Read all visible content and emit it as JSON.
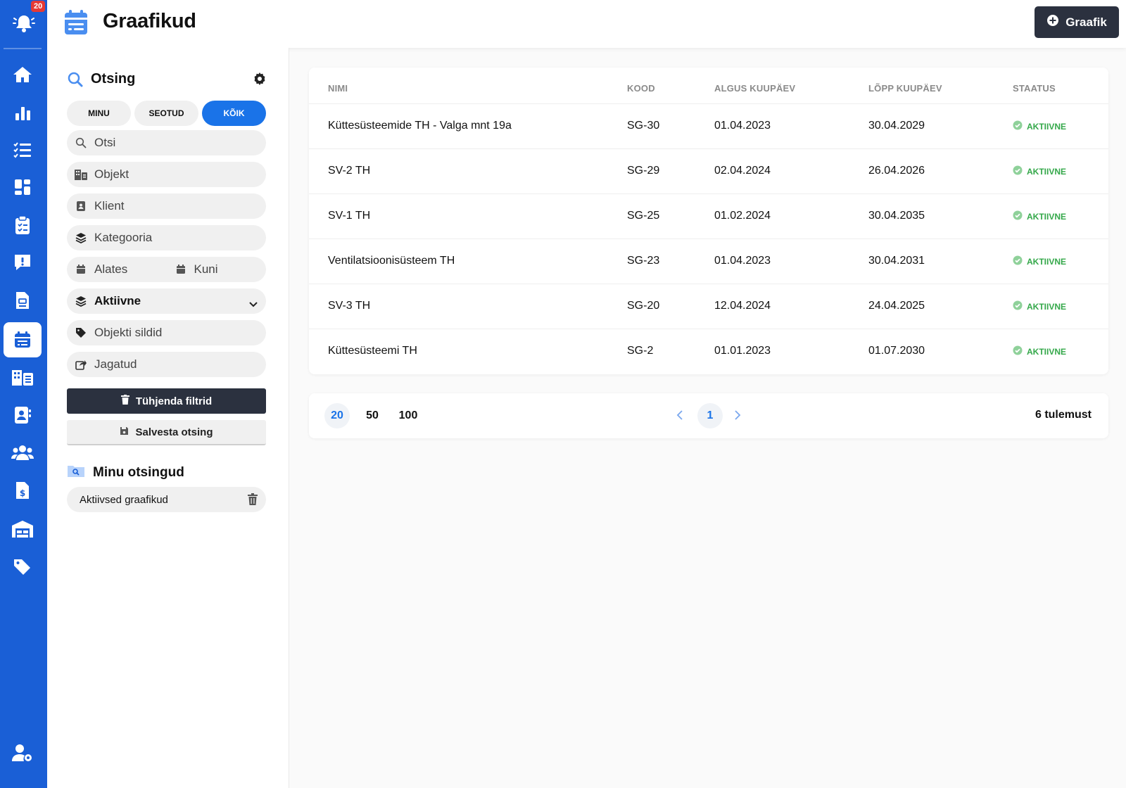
{
  "app": {
    "title": "Graafikud",
    "add_button": "Graafik"
  },
  "nav": {
    "notification_count": "20"
  },
  "search": {
    "title": "Otsing",
    "scopes": [
      {
        "label": "MINU",
        "active": false
      },
      {
        "label": "SEOTUD",
        "active": false
      },
      {
        "label": "KÕIK",
        "active": true
      }
    ],
    "text_placeholder": "Otsi",
    "object_placeholder": "Objekt",
    "client_placeholder": "Klient",
    "category_placeholder": "Kategooria",
    "date_from_placeholder": "Alates",
    "date_to_placeholder": "Kuni",
    "status_value": "Aktiivne",
    "tags_placeholder": "Objekti sildid",
    "shared_placeholder": "Jagatud",
    "clear_button": "Tühjenda filtrid",
    "save_button": "Salvesta otsing"
  },
  "saved_searches": {
    "title": "Minu otsingud",
    "items": [
      {
        "label": "Aktiivsed graafikud"
      }
    ]
  },
  "table": {
    "columns": [
      "NIMI",
      "KOOD",
      "ALGUS KUUPÄEV",
      "LÕPP KUUPÄEV",
      "STAATUS"
    ],
    "rows": [
      {
        "name": "Küttesüsteemide TH - Valga mnt 19a",
        "code": "SG-30",
        "start": "01.04.2023",
        "end": "30.04.2029",
        "status": "AKTIIVNE"
      },
      {
        "name": "SV-2 TH",
        "code": "SG-29",
        "start": "02.04.2024",
        "end": "26.04.2026",
        "status": "AKTIIVNE"
      },
      {
        "name": "SV-1 TH",
        "code": "SG-25",
        "start": "01.02.2024",
        "end": "30.04.2035",
        "status": "AKTIIVNE"
      },
      {
        "name": "Ventilatsioonisüsteem TH",
        "code": "SG-23",
        "start": "01.04.2023",
        "end": "30.04.2031",
        "status": "AKTIIVNE"
      },
      {
        "name": "SV-3 TH",
        "code": "SG-20",
        "start": "12.04.2024",
        "end": "24.04.2025",
        "status": "AKTIIVNE"
      },
      {
        "name": "Küttesüsteemi TH",
        "code": "SG-2",
        "start": "01.01.2023",
        "end": "01.07.2030",
        "status": "AKTIIVNE"
      }
    ]
  },
  "pagination": {
    "page_sizes": [
      "20",
      "50",
      "100"
    ],
    "current_page": "1",
    "total": "6 tulemust"
  },
  "colors": {
    "primary": "#1a5fd6",
    "accent": "#1a73e8",
    "dark_button": "#2b313f",
    "status_active": "#34a84a"
  }
}
